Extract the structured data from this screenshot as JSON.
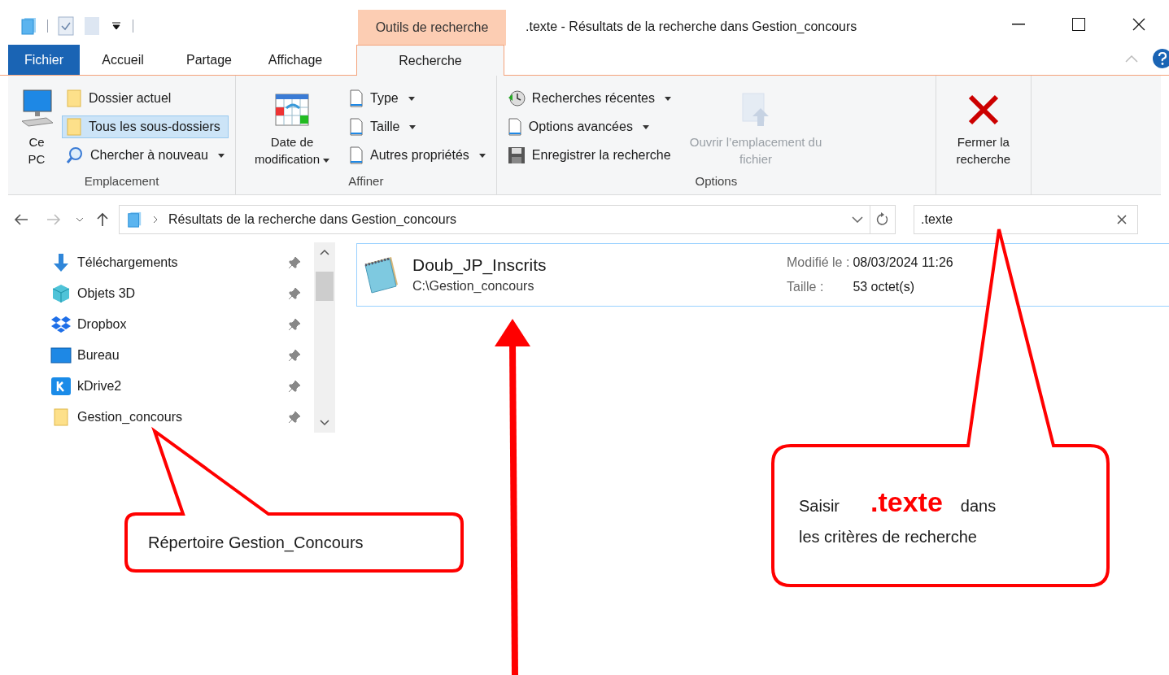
{
  "window": {
    "title": ".texte - Résultats de la recherche dans Gestion_concours",
    "context_tab": "Outils de recherche"
  },
  "ribbon_tabs": [
    {
      "label": "Fichier",
      "kind": "file",
      "selected": false
    },
    {
      "label": "Accueil",
      "kind": "tab",
      "selected": false
    },
    {
      "label": "Partage",
      "kind": "tab",
      "selected": false
    },
    {
      "label": "Affichage",
      "kind": "tab",
      "selected": false
    },
    {
      "label": "Recherche",
      "kind": "tab",
      "selected": true
    }
  ],
  "ribbon_groups": [
    {
      "label": "Emplacement",
      "items": [
        {
          "kind": "large",
          "label": "Ce PC",
          "dropdown": false,
          "disabled": false,
          "selected": false
        },
        {
          "kind": "small",
          "label": "Dossier actuel",
          "dropdown": false,
          "disabled": false,
          "selected": false
        },
        {
          "kind": "small",
          "label": "Tous les sous-dossiers",
          "dropdown": false,
          "disabled": false,
          "selected": true
        },
        {
          "kind": "small",
          "label": "Chercher à nouveau",
          "dropdown": true,
          "disabled": false,
          "selected": false
        }
      ]
    },
    {
      "label": "Affiner",
      "items": [
        {
          "kind": "large",
          "label": "Date de modification",
          "dropdown": true,
          "disabled": false,
          "selected": false
        },
        {
          "kind": "small",
          "label": "Type",
          "dropdown": true,
          "disabled": false,
          "selected": false
        },
        {
          "kind": "small",
          "label": "Taille",
          "dropdown": true,
          "disabled": false,
          "selected": false
        },
        {
          "kind": "small",
          "label": "Autres propriétés",
          "dropdown": true,
          "disabled": false,
          "selected": false
        }
      ]
    },
    {
      "label": "Options",
      "items": [
        {
          "kind": "small",
          "label": "Recherches récentes",
          "dropdown": true,
          "disabled": false,
          "selected": false
        },
        {
          "kind": "small",
          "label": "Options avancées",
          "dropdown": true,
          "disabled": false,
          "selected": false
        },
        {
          "kind": "small",
          "label": "Enregistrer la recherche",
          "dropdown": false,
          "disabled": false,
          "selected": false
        },
        {
          "kind": "large",
          "label": "Ouvrir l’emplacement du fichier",
          "dropdown": false,
          "disabled": true,
          "selected": false
        }
      ]
    },
    {
      "items": [
        {
          "kind": "large",
          "label": "Fermer la recherche",
          "dropdown": false,
          "disabled": false,
          "selected": false
        }
      ]
    }
  ],
  "address_bar": {
    "path": "Résultats de la recherche dans Gestion_concours"
  },
  "search": {
    "value": ".texte"
  },
  "navigation_pane": [
    {
      "label": "Téléchargements"
    },
    {
      "label": "Objets 3D"
    },
    {
      "label": "Dropbox"
    },
    {
      "label": "Bureau"
    },
    {
      "label": "kDrive2"
    },
    {
      "label": "Gestion_concours"
    }
  ],
  "results": [
    {
      "name": "Doub_JP_Inscrits",
      "path": "C:\\Gestion_concours",
      "modified_label": "Modifié le :",
      "modified": "08/03/2024 11:26",
      "size_label": "Taille :",
      "size": "53 octet(s)"
    }
  ],
  "annotations": {
    "folder_callout": "Répertoire Gestion_Concours",
    "search_callout": {
      "before": "Saisir",
      "keyword": ".texte",
      "after": "dans",
      "line2": "les critères de recherche"
    }
  }
}
